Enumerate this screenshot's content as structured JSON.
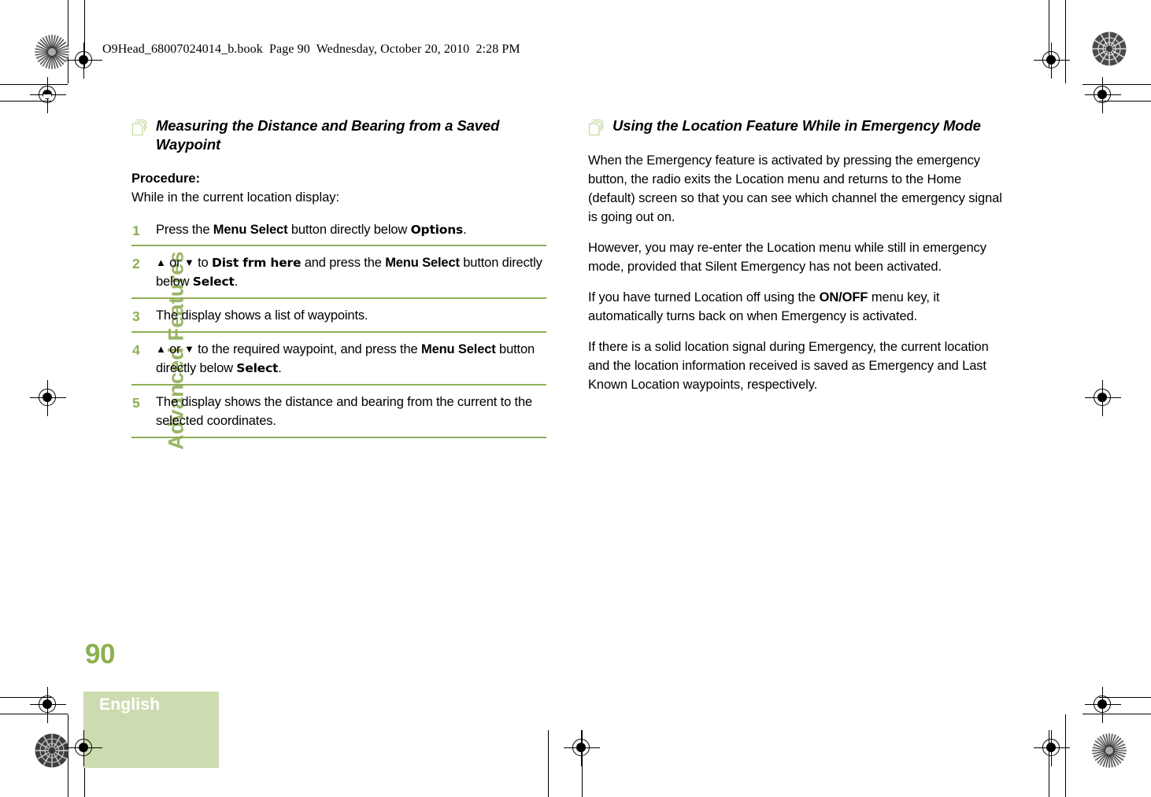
{
  "header": {
    "file_line": "O9Head_68007024014_b.book  Page 90  Wednesday, October 20, 2010  2:28 PM"
  },
  "sidebar": {
    "chapter_tab": "Advanced Features",
    "page_number": "90",
    "language": "English"
  },
  "colors": {
    "accent_green": "#8cb04f",
    "rule_green": "#8fae57",
    "tab_green": "#9ab564",
    "lang_box_green": "#cddcb0",
    "icon_green": "#c7d9a4"
  },
  "left_column": {
    "heading": "Measuring the Distance and Bearing from a Saved Waypoint",
    "heading_icon": "stacked-pages-icon",
    "procedure_label": "Procedure:",
    "procedure_intro": "While in the current location display:",
    "steps": [
      {
        "number": "1",
        "parts": [
          {
            "text": "Press the ",
            "style": "normal"
          },
          {
            "text": "Menu Select",
            "style": "bold"
          },
          {
            "text": " button directly below ",
            "style": "normal"
          },
          {
            "text": "Options",
            "style": "lcd"
          },
          {
            "text": ".",
            "style": "normal"
          }
        ]
      },
      {
        "number": "2",
        "parts": [
          {
            "text": "▲",
            "style": "arrow"
          },
          {
            "text": " or ",
            "style": "normal"
          },
          {
            "text": "▼",
            "style": "arrow"
          },
          {
            "text": " to ",
            "style": "normal"
          },
          {
            "text": "Dist frm here",
            "style": "lcd"
          },
          {
            "text": " and press the ",
            "style": "normal"
          },
          {
            "text": "Menu Select",
            "style": "bold"
          },
          {
            "text": " button directly below ",
            "style": "normal"
          },
          {
            "text": "Select",
            "style": "lcd"
          },
          {
            "text": ".",
            "style": "normal"
          }
        ]
      },
      {
        "number": "3",
        "parts": [
          {
            "text": "The display shows a list of waypoints.",
            "style": "normal"
          }
        ]
      },
      {
        "number": "4",
        "parts": [
          {
            "text": "▲",
            "style": "arrow"
          },
          {
            "text": " or ",
            "style": "normal"
          },
          {
            "text": "▼",
            "style": "arrow"
          },
          {
            "text": " to the required waypoint, and press the ",
            "style": "normal"
          },
          {
            "text": "Menu Select",
            "style": "bold"
          },
          {
            "text": " button directly below ",
            "style": "normal"
          },
          {
            "text": "Select",
            "style": "lcd"
          },
          {
            "text": ".",
            "style": "normal"
          }
        ]
      },
      {
        "number": "5",
        "parts": [
          {
            "text": "The display shows the distance and bearing from the current to the selected coordinates.",
            "style": "normal"
          }
        ]
      }
    ]
  },
  "right_column": {
    "heading": "Using the Location Feature While in Emergency Mode",
    "heading_icon": "stacked-pages-icon",
    "paragraphs": [
      {
        "parts": [
          {
            "text": "When the Emergency feature is activated by pressing the emergency button, the radio exits the Location menu and returns to the Home (default) screen so that you can see which channel the emergency signal is going out on.",
            "style": "normal"
          }
        ]
      },
      {
        "parts": [
          {
            "text": "However, you may re-enter the Location menu while still in emergency mode, provided that Silent Emergency has not been activated.",
            "style": "normal"
          }
        ]
      },
      {
        "parts": [
          {
            "text": "If you have turned Location off using the ",
            "style": "normal"
          },
          {
            "text": "ON/OFF",
            "style": "bold"
          },
          {
            "text": " menu key, it automatically turns back on when Emergency is activated.",
            "style": "normal"
          }
        ]
      },
      {
        "parts": [
          {
            "text": "If there is a solid location signal during Emergency, the current location and the location information received is saved as Emergency and Last Known Location waypoints, respectively.",
            "style": "normal"
          }
        ]
      }
    ]
  }
}
